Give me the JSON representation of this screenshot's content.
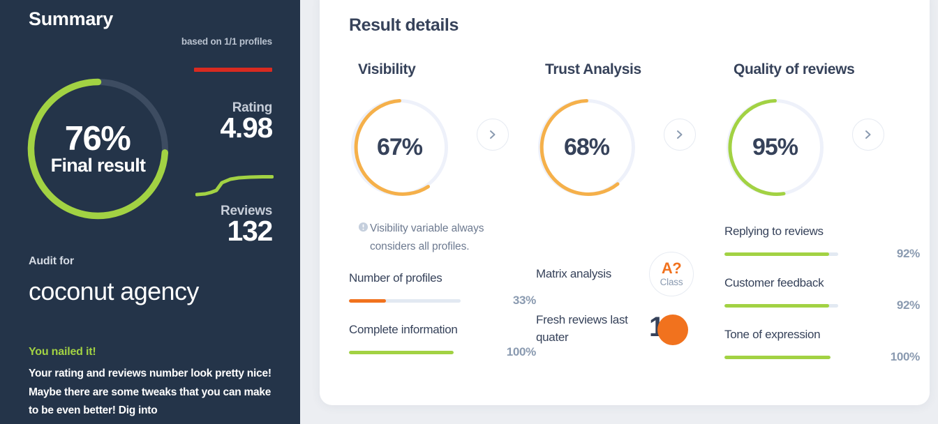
{
  "sidebar": {
    "title": "Summary",
    "based_on": "based on 1/1 profiles",
    "final_donut": {
      "value": "76%",
      "caption": "Final result",
      "percent": 76,
      "color": "#a2d243"
    },
    "stats": [
      {
        "label": "Rating",
        "value": "4.98",
        "accent_color": "#d92a20"
      },
      {
        "label": "Reviews",
        "value": "132",
        "accent_color": "#a2d243"
      }
    ],
    "audit_for_label": "Audit for",
    "agency_name": "coconut agency",
    "verdict_title": "You nailed it!",
    "verdict_body": "Your rating and reviews number look pretty nice! Maybe there are some tweaks that you can make to be even better! Dig into"
  },
  "main": {
    "title": "Result details",
    "chevron_icon": "chevron-right-icon",
    "columns": [
      {
        "heading": "Visibility",
        "donut": {
          "value": "67%",
          "percent": 67,
          "color": "#f5b04a"
        },
        "note": {
          "icon": "info-icon",
          "text": "Visibility variable always considers all profiles."
        },
        "metrics": [
          {
            "label": "Number of profiles",
            "value": "33%",
            "percent": 33,
            "color": "#f1721e"
          },
          {
            "label": "Complete information",
            "value": "100%",
            "percent": 100,
            "color": "#a2d243"
          }
        ]
      },
      {
        "heading": "Trust Analysis",
        "donut": {
          "value": "68%",
          "percent": 68,
          "color": "#f5b04a"
        },
        "rows": [
          {
            "label": "Matrix analysis",
            "badge": {
              "grade": "A?",
              "sub": "Class",
              "color": "#f1721e"
            }
          },
          {
            "label": "Fresh reviews last quater",
            "count": "1",
            "dot_color": "#f1721e"
          }
        ]
      },
      {
        "heading": "Quality of reviews",
        "donut": {
          "value": "95%",
          "percent": 95,
          "color": "#a2d243"
        },
        "metrics": [
          {
            "label": "Replying to reviews",
            "value": "92%",
            "percent": 92,
            "color": "#a2d243"
          },
          {
            "label": "Customer feedback",
            "value": "92%",
            "percent": 92,
            "color": "#a2d243"
          },
          {
            "label": "Tone of expression",
            "value": "100%",
            "percent": 100,
            "color": "#a2d243"
          }
        ]
      }
    ]
  },
  "chart_data": {
    "type": "bar",
    "title": "Result details",
    "categories": [
      "Final result",
      "Rating",
      "Reviews",
      "Visibility",
      "Trust Analysis",
      "Quality of reviews",
      "Number of profiles",
      "Complete information",
      "Replying to reviews",
      "Customer feedback",
      "Tone of expression",
      "Fresh reviews last quater"
    ],
    "values": [
      76,
      4.98,
      132,
      67,
      68,
      95,
      33,
      100,
      92,
      92,
      100,
      1
    ],
    "units": [
      "%",
      "stars",
      "count",
      "%",
      "%",
      "%",
      "%",
      "%",
      "%",
      "%",
      "%",
      "count"
    ],
    "xlabel": "",
    "ylabel": "",
    "ylim": [
      0,
      100
    ]
  }
}
